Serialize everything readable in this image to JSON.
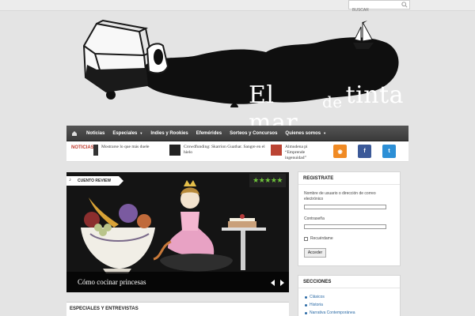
{
  "search": {
    "placeholder": "BUSCAR"
  },
  "logo": {
    "word1": "El mar",
    "word2": "de",
    "word3": "tinta"
  },
  "nav": {
    "items": [
      {
        "label": "Noticias",
        "dropdown": false
      },
      {
        "label": "Especiales",
        "dropdown": true
      },
      {
        "label": "Indies y Rookies",
        "dropdown": false
      },
      {
        "label": "Efemérides",
        "dropdown": false
      },
      {
        "label": "Sorteos y Concursos",
        "dropdown": false
      },
      {
        "label": "Quienes somos",
        "dropdown": true
      }
    ]
  },
  "ticker": {
    "label": "NOTICIAS",
    "items": [
      {
        "text": "Mostrarse lo que más duele"
      },
      {
        "text": "Crowdfunding: Skarrion Guathar. Sangre en el hielo"
      },
      {
        "text": "Almudena pi “Emprende ingenuidad”"
      }
    ]
  },
  "socials": [
    {
      "name": "rss",
      "color": "#f08a24",
      "glyph": "◉"
    },
    {
      "name": "facebook",
      "color": "#3b5998",
      "glyph": "f"
    },
    {
      "name": "twitter",
      "color": "#2c8fd6",
      "glyph": "t"
    }
  ],
  "feature": {
    "tag": "CUENTO REVIEW",
    "stars": "★★★★★",
    "rating": 5,
    "caption": "Cómo cocinar princesas"
  },
  "section_below": {
    "title": "ESPECIALES Y ENTREVISTAS"
  },
  "login": {
    "title": "REGISTRATE",
    "user_label": "Nombre de usuario o dirección de correo electrónico",
    "pass_label": "Contraseña",
    "remember_label": "Recuérdame",
    "submit_label": "Acceder"
  },
  "sections": {
    "title": "SECCIONES",
    "items": [
      "Clásicos",
      "Historia",
      "Narrativa Contemporánea"
    ]
  }
}
